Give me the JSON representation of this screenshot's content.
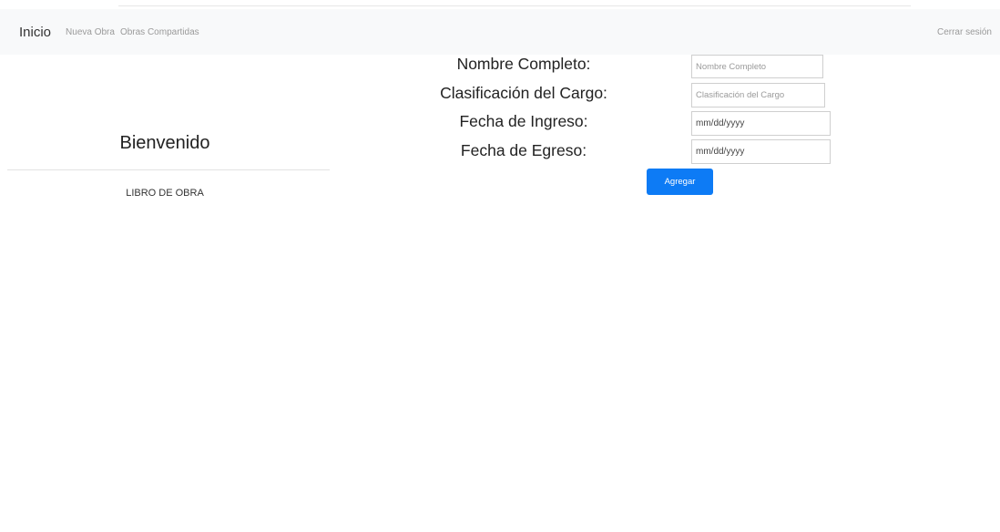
{
  "navbar": {
    "brand": "Inicio",
    "links": [
      "Nueva Obra",
      "Obras Compartidas"
    ],
    "logout": "Cerrar sesión"
  },
  "sidebar": {
    "welcome": "Bienvenido",
    "items": [
      {
        "label": "LIBRO DE OBRA"
      }
    ]
  },
  "form": {
    "fields": [
      {
        "label": "Nombre Completo:",
        "placeholder": "Nombre Completo"
      },
      {
        "label": "Clasificación del Cargo:",
        "placeholder": "Clasificación del Cargo"
      },
      {
        "label": "Fecha de Ingreso:",
        "value": "mm/dd/yyyy"
      },
      {
        "label": "Fecha de Egreso:",
        "value": "mm/dd/yyyy"
      }
    ],
    "submit_label": "Agregar"
  },
  "colors": {
    "navbar_bg": "#f8f9fa",
    "primary_button": "#0d7bf5"
  }
}
